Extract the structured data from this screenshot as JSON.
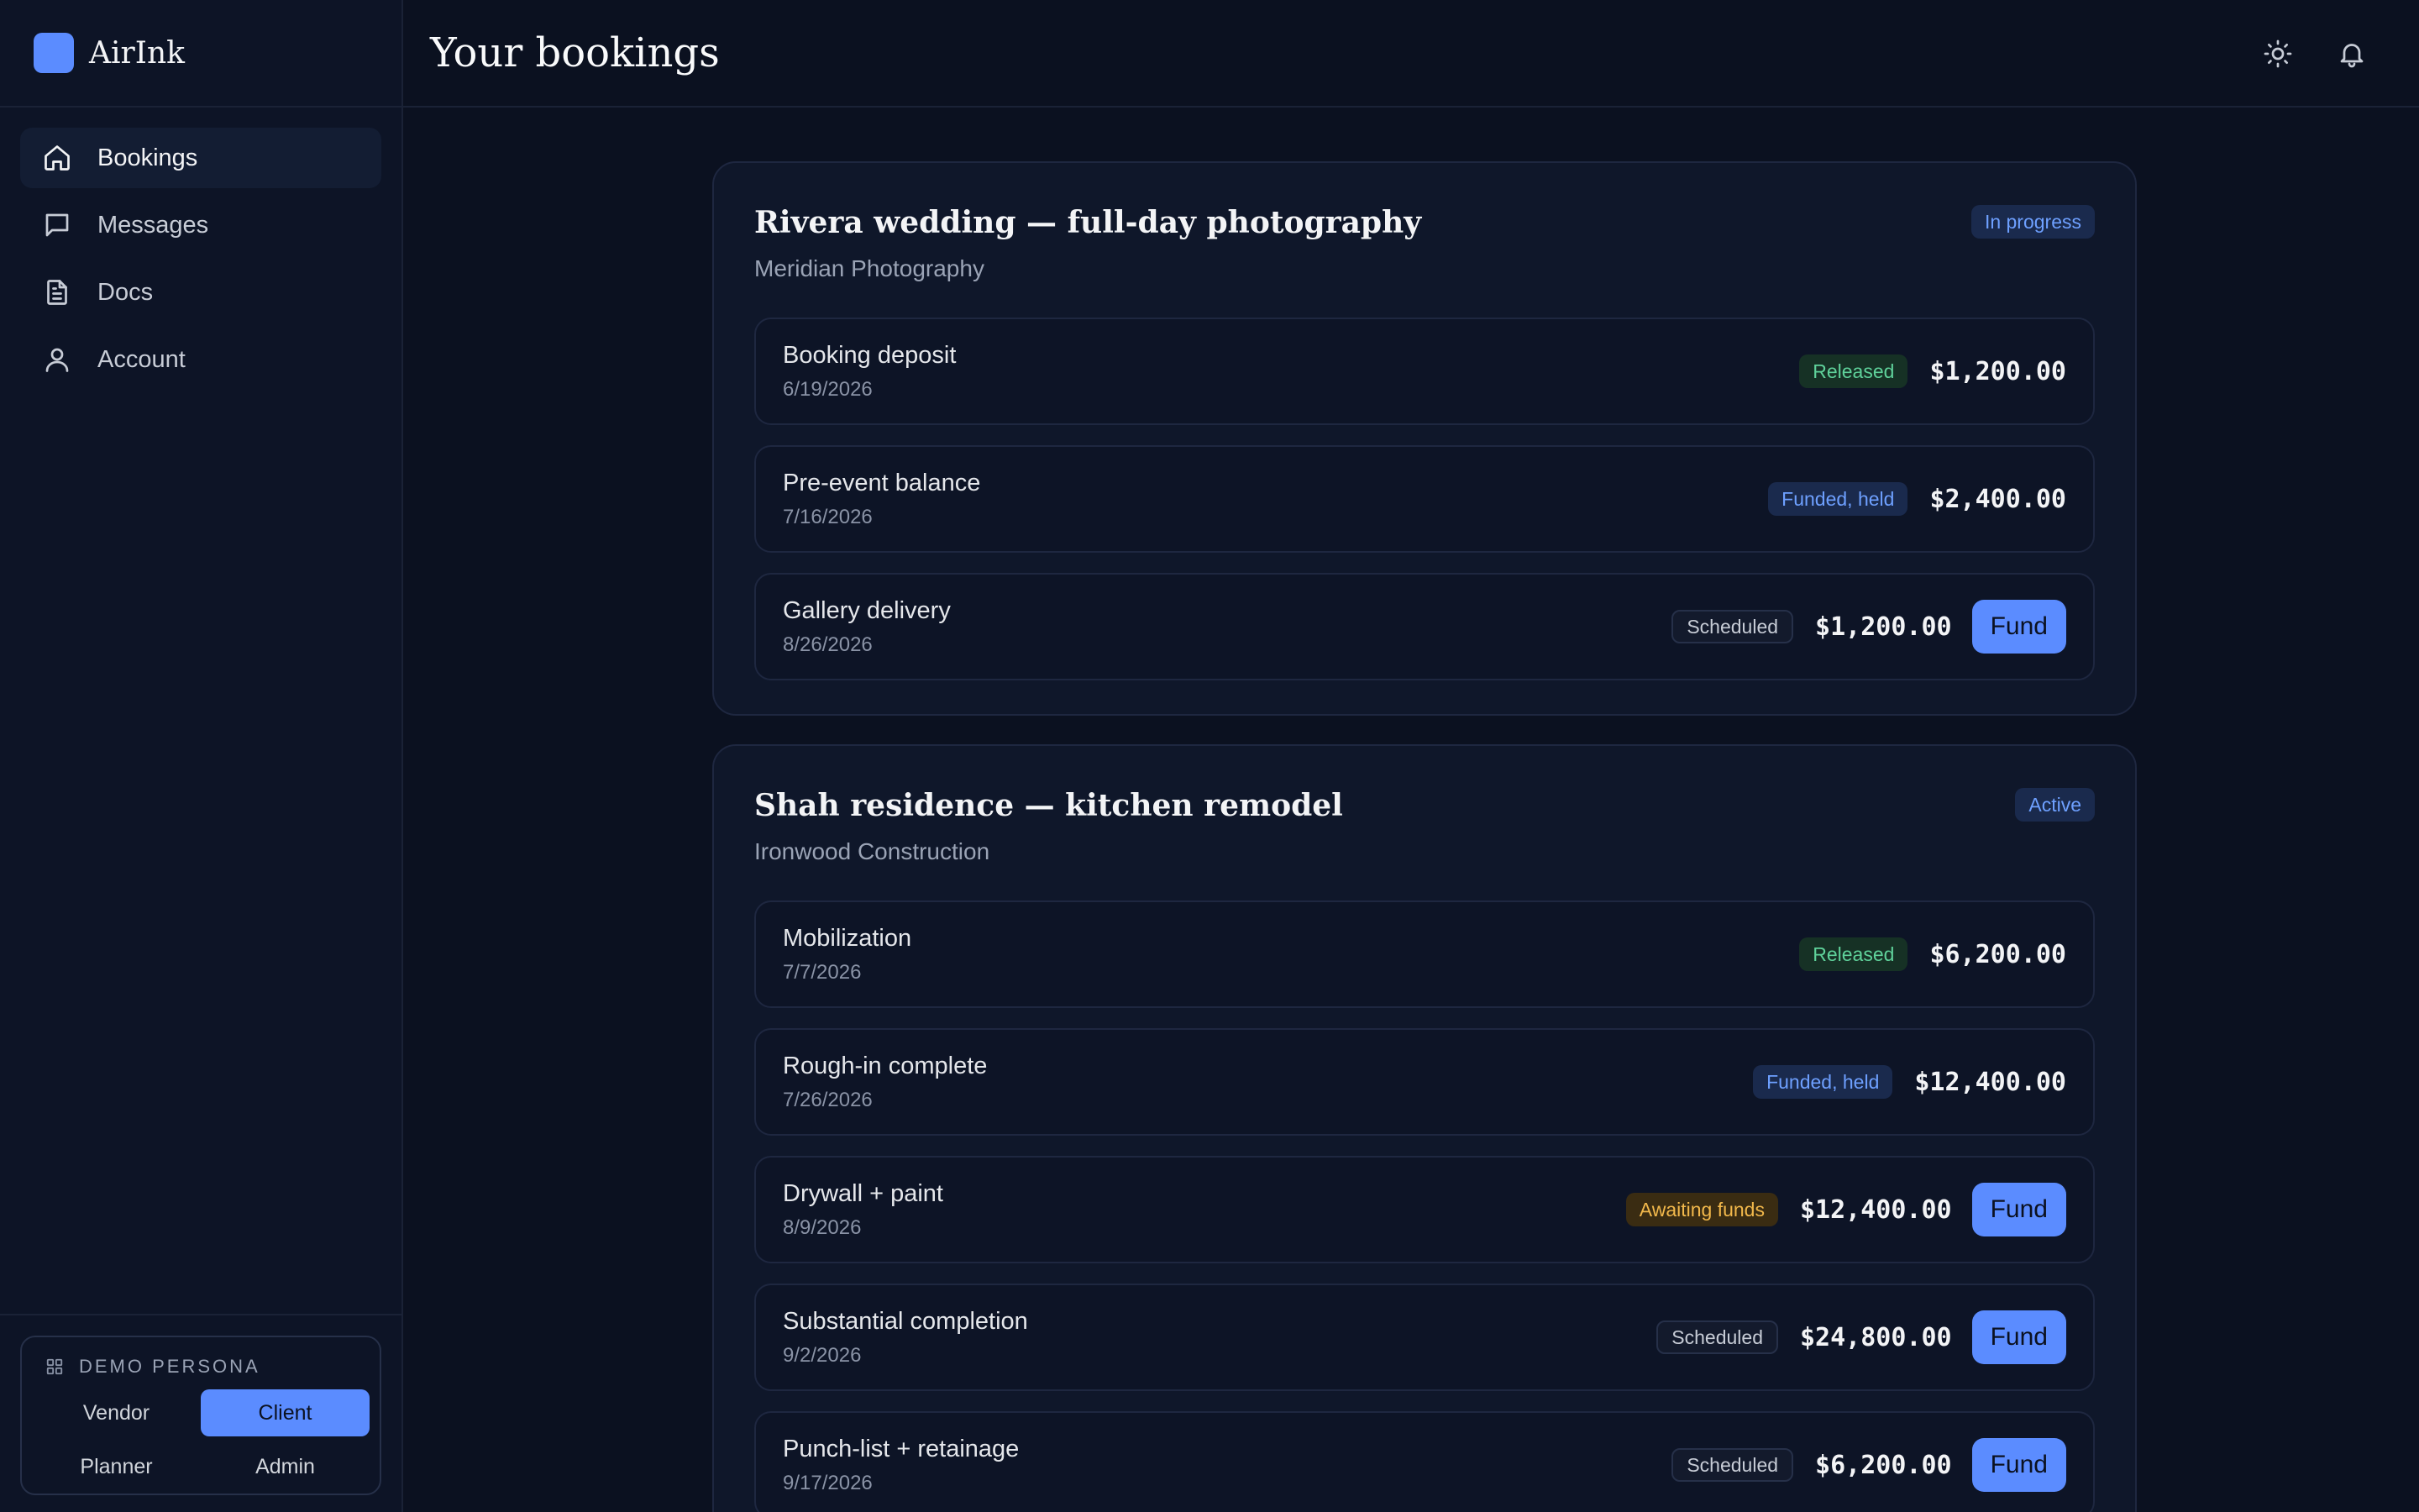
{
  "app": {
    "name": "AirInk"
  },
  "sidebar": {
    "items": [
      {
        "label": "Bookings",
        "icon": "home-icon",
        "active": true
      },
      {
        "label": "Messages",
        "icon": "message-icon",
        "active": false
      },
      {
        "label": "Docs",
        "icon": "document-icon",
        "active": false
      },
      {
        "label": "Account",
        "icon": "user-icon",
        "active": false
      }
    ],
    "persona": {
      "title": "DEMO PERSONA",
      "options": [
        "Vendor",
        "Client",
        "Planner",
        "Admin"
      ],
      "selected": "Client"
    }
  },
  "header": {
    "title": "Your bookings"
  },
  "bookings": [
    {
      "title": "Rivera wedding — full-day photography",
      "vendor": "Meridian Photography",
      "status": "In progress",
      "milestones": [
        {
          "name": "Booking deposit",
          "date": "6/19/2026",
          "status": "Released",
          "amount": "$1,200.00"
        },
        {
          "name": "Pre-event balance",
          "date": "7/16/2026",
          "status": "Funded, held",
          "amount": "$2,400.00"
        },
        {
          "name": "Gallery delivery",
          "date": "8/26/2026",
          "status": "Scheduled",
          "amount": "$1,200.00",
          "action": "Fund"
        }
      ]
    },
    {
      "title": "Shah residence — kitchen remodel",
      "vendor": "Ironwood Construction",
      "status": "Active",
      "milestones": [
        {
          "name": "Mobilization",
          "date": "7/7/2026",
          "status": "Released",
          "amount": "$6,200.00"
        },
        {
          "name": "Rough-in complete",
          "date": "7/26/2026",
          "status": "Funded, held",
          "amount": "$12,400.00"
        },
        {
          "name": "Drywall + paint",
          "date": "8/9/2026",
          "status": "Awaiting funds",
          "amount": "$12,400.00",
          "action": "Fund"
        },
        {
          "name": "Substantial completion",
          "date": "9/2/2026",
          "status": "Scheduled",
          "amount": "$24,800.00",
          "action": "Fund"
        },
        {
          "name": "Punch-list + retainage",
          "date": "9/17/2026",
          "status": "Scheduled",
          "amount": "$6,200.00",
          "action": "Fund"
        }
      ]
    }
  ],
  "colors": {
    "accent": "#5b8cff",
    "released": "#5fd19a",
    "funded": "#6ea0ff",
    "awaiting": "#f2b84b",
    "background": "#0b1120"
  }
}
